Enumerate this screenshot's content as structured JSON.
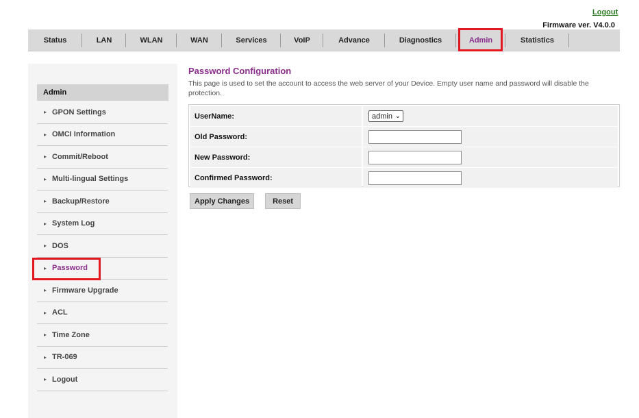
{
  "header": {
    "logout_link": "Logout",
    "firmware": "Firmware ver. V4.0.0"
  },
  "topnav": {
    "tabs": [
      {
        "label": "Status"
      },
      {
        "label": "LAN"
      },
      {
        "label": "WLAN"
      },
      {
        "label": "WAN"
      },
      {
        "label": "Services"
      },
      {
        "label": "VoIP"
      },
      {
        "label": "Advance"
      },
      {
        "label": "Diagnostics"
      },
      {
        "label": "Admin"
      },
      {
        "label": "Statistics"
      }
    ],
    "active": "Admin"
  },
  "sidebar": {
    "header": "Admin",
    "items": [
      {
        "label": "GPON Settings"
      },
      {
        "label": "OMCI Information"
      },
      {
        "label": "Commit/Reboot"
      },
      {
        "label": "Multi-lingual Settings"
      },
      {
        "label": "Backup/Restore"
      },
      {
        "label": "System Log"
      },
      {
        "label": "DOS"
      },
      {
        "label": "Password"
      },
      {
        "label": "Firmware Upgrade"
      },
      {
        "label": "ACL"
      },
      {
        "label": "Time Zone"
      },
      {
        "label": "TR-069"
      },
      {
        "label": "Logout"
      }
    ],
    "active": "Password"
  },
  "main": {
    "title": "Password Configuration",
    "description": "This page is used to set the account to access the web server of your Device. Empty user name and password will disable the protection.",
    "form": {
      "username_label": "UserName:",
      "username_value": "admin",
      "old_password_label": "Old Password:",
      "old_password_value": "",
      "new_password_label": "New Password:",
      "new_password_value": "",
      "confirm_password_label": "Confirmed Password:",
      "confirm_password_value": ""
    },
    "buttons": {
      "apply": "Apply Changes",
      "reset": "Reset"
    }
  },
  "colors": {
    "accent": "#8a2d8c",
    "highlight": "#e2171f",
    "logout_link": "#2a7a1f",
    "nav_bg": "#d9d9d9"
  }
}
